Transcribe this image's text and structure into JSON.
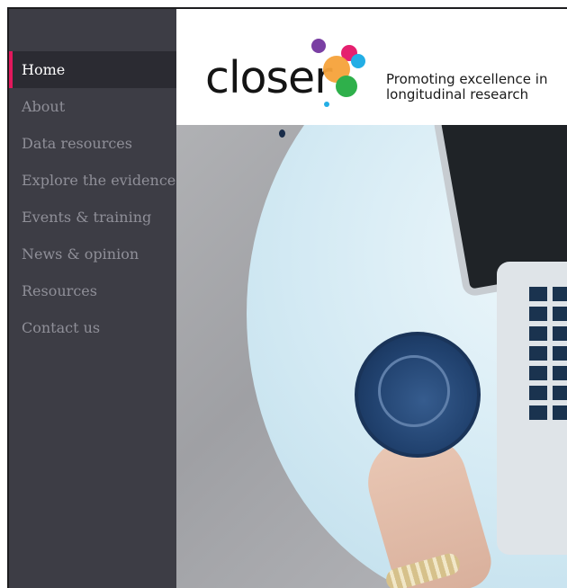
{
  "sidebar": {
    "items": [
      {
        "label": "Home",
        "active": true
      },
      {
        "label": "About",
        "active": false
      },
      {
        "label": "Data resources",
        "active": false
      },
      {
        "label": "Explore the evidence",
        "active": false
      },
      {
        "label": "Events & training",
        "active": false
      },
      {
        "label": "News & opinion",
        "active": false
      },
      {
        "label": "Resources",
        "active": false
      },
      {
        "label": "Contact us",
        "active": false
      }
    ]
  },
  "header": {
    "logo_text": "closer",
    "tagline_line1": "Promoting excellence in",
    "tagline_line2": "longitudinal research"
  },
  "colors": {
    "sidebar_bg": "#3d3d45",
    "active_item_bg": "#2b2b32",
    "active_accent": "#e2185c",
    "logo_dot_purple": "#7a3fa3",
    "logo_dot_magenta": "#e5206f",
    "logo_dot_orange": "#f6a23a",
    "logo_dot_cyan": "#23aee5",
    "logo_dot_green": "#2fb04b"
  }
}
